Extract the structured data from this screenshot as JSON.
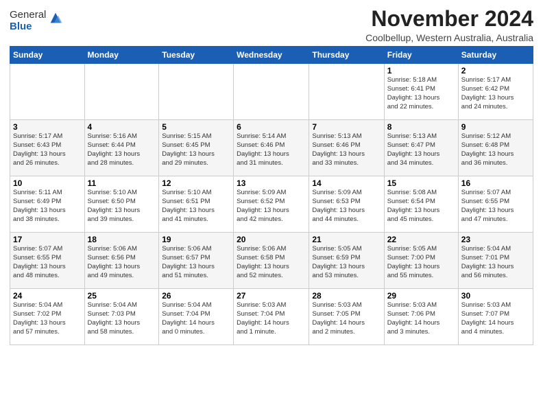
{
  "logo": {
    "general": "General",
    "blue": "Blue"
  },
  "header": {
    "month": "November 2024",
    "location": "Coolbellup, Western Australia, Australia"
  },
  "days_of_week": [
    "Sunday",
    "Monday",
    "Tuesday",
    "Wednesday",
    "Thursday",
    "Friday",
    "Saturday"
  ],
  "weeks": [
    [
      {
        "day": "",
        "info": ""
      },
      {
        "day": "",
        "info": ""
      },
      {
        "day": "",
        "info": ""
      },
      {
        "day": "",
        "info": ""
      },
      {
        "day": "",
        "info": ""
      },
      {
        "day": "1",
        "info": "Sunrise: 5:18 AM\nSunset: 6:41 PM\nDaylight: 13 hours\nand 22 minutes."
      },
      {
        "day": "2",
        "info": "Sunrise: 5:17 AM\nSunset: 6:42 PM\nDaylight: 13 hours\nand 24 minutes."
      }
    ],
    [
      {
        "day": "3",
        "info": "Sunrise: 5:17 AM\nSunset: 6:43 PM\nDaylight: 13 hours\nand 26 minutes."
      },
      {
        "day": "4",
        "info": "Sunrise: 5:16 AM\nSunset: 6:44 PM\nDaylight: 13 hours\nand 28 minutes."
      },
      {
        "day": "5",
        "info": "Sunrise: 5:15 AM\nSunset: 6:45 PM\nDaylight: 13 hours\nand 29 minutes."
      },
      {
        "day": "6",
        "info": "Sunrise: 5:14 AM\nSunset: 6:46 PM\nDaylight: 13 hours\nand 31 minutes."
      },
      {
        "day": "7",
        "info": "Sunrise: 5:13 AM\nSunset: 6:46 PM\nDaylight: 13 hours\nand 33 minutes."
      },
      {
        "day": "8",
        "info": "Sunrise: 5:13 AM\nSunset: 6:47 PM\nDaylight: 13 hours\nand 34 minutes."
      },
      {
        "day": "9",
        "info": "Sunrise: 5:12 AM\nSunset: 6:48 PM\nDaylight: 13 hours\nand 36 minutes."
      }
    ],
    [
      {
        "day": "10",
        "info": "Sunrise: 5:11 AM\nSunset: 6:49 PM\nDaylight: 13 hours\nand 38 minutes."
      },
      {
        "day": "11",
        "info": "Sunrise: 5:10 AM\nSunset: 6:50 PM\nDaylight: 13 hours\nand 39 minutes."
      },
      {
        "day": "12",
        "info": "Sunrise: 5:10 AM\nSunset: 6:51 PM\nDaylight: 13 hours\nand 41 minutes."
      },
      {
        "day": "13",
        "info": "Sunrise: 5:09 AM\nSunset: 6:52 PM\nDaylight: 13 hours\nand 42 minutes."
      },
      {
        "day": "14",
        "info": "Sunrise: 5:09 AM\nSunset: 6:53 PM\nDaylight: 13 hours\nand 44 minutes."
      },
      {
        "day": "15",
        "info": "Sunrise: 5:08 AM\nSunset: 6:54 PM\nDaylight: 13 hours\nand 45 minutes."
      },
      {
        "day": "16",
        "info": "Sunrise: 5:07 AM\nSunset: 6:55 PM\nDaylight: 13 hours\nand 47 minutes."
      }
    ],
    [
      {
        "day": "17",
        "info": "Sunrise: 5:07 AM\nSunset: 6:55 PM\nDaylight: 13 hours\nand 48 minutes."
      },
      {
        "day": "18",
        "info": "Sunrise: 5:06 AM\nSunset: 6:56 PM\nDaylight: 13 hours\nand 49 minutes."
      },
      {
        "day": "19",
        "info": "Sunrise: 5:06 AM\nSunset: 6:57 PM\nDaylight: 13 hours\nand 51 minutes."
      },
      {
        "day": "20",
        "info": "Sunrise: 5:06 AM\nSunset: 6:58 PM\nDaylight: 13 hours\nand 52 minutes."
      },
      {
        "day": "21",
        "info": "Sunrise: 5:05 AM\nSunset: 6:59 PM\nDaylight: 13 hours\nand 53 minutes."
      },
      {
        "day": "22",
        "info": "Sunrise: 5:05 AM\nSunset: 7:00 PM\nDaylight: 13 hours\nand 55 minutes."
      },
      {
        "day": "23",
        "info": "Sunrise: 5:04 AM\nSunset: 7:01 PM\nDaylight: 13 hours\nand 56 minutes."
      }
    ],
    [
      {
        "day": "24",
        "info": "Sunrise: 5:04 AM\nSunset: 7:02 PM\nDaylight: 13 hours\nand 57 minutes."
      },
      {
        "day": "25",
        "info": "Sunrise: 5:04 AM\nSunset: 7:03 PM\nDaylight: 13 hours\nand 58 minutes."
      },
      {
        "day": "26",
        "info": "Sunrise: 5:04 AM\nSunset: 7:04 PM\nDaylight: 14 hours\nand 0 minutes."
      },
      {
        "day": "27",
        "info": "Sunrise: 5:03 AM\nSunset: 7:04 PM\nDaylight: 14 hours\nand 1 minute."
      },
      {
        "day": "28",
        "info": "Sunrise: 5:03 AM\nSunset: 7:05 PM\nDaylight: 14 hours\nand 2 minutes."
      },
      {
        "day": "29",
        "info": "Sunrise: 5:03 AM\nSunset: 7:06 PM\nDaylight: 14 hours\nand 3 minutes."
      },
      {
        "day": "30",
        "info": "Sunrise: 5:03 AM\nSunset: 7:07 PM\nDaylight: 14 hours\nand 4 minutes."
      }
    ]
  ]
}
